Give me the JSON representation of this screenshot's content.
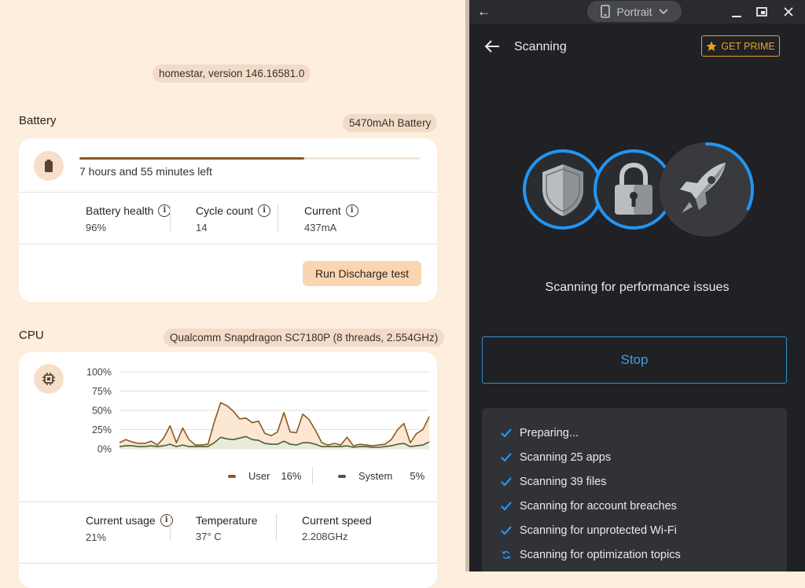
{
  "left": {
    "version_chip": "homestar, version 146.16581.0",
    "battery": {
      "title": "Battery",
      "chip": "5470mAh Battery",
      "time_left": "7 hours and 55 minutes left",
      "charge_fraction": 0.66,
      "stats": [
        {
          "label": "Battery health",
          "value": "96%"
        },
        {
          "label": "Cycle count",
          "value": "14"
        },
        {
          "label": "Current",
          "value": "437mA"
        }
      ],
      "discharge_button": "Run Discharge test"
    },
    "cpu": {
      "title": "CPU",
      "chip": "Qualcomm Snapdragon SC7180P (8 threads, 2.554GHz)",
      "legend": [
        {
          "label": "User",
          "value": "16%",
          "color": "#8a5a1e"
        },
        {
          "label": "System",
          "value": "5%",
          "color": "#4b5e3c"
        }
      ],
      "stats": [
        {
          "label": "Current usage",
          "value": "21%"
        },
        {
          "label": "Temperature",
          "value": "37° C"
        },
        {
          "label": "Current speed",
          "value": "2.208GHz"
        }
      ]
    }
  },
  "chart_data": {
    "type": "area",
    "y_ticks": [
      "100%",
      "75%",
      "50%",
      "25%",
      "0%"
    ],
    "ylim": [
      0,
      100
    ],
    "grid": true,
    "x": [
      0,
      1,
      2,
      3,
      4,
      5,
      6,
      7,
      8,
      9,
      10,
      11,
      12,
      13,
      14,
      15,
      16,
      17,
      18,
      19,
      20,
      21,
      22,
      23,
      24,
      25,
      26,
      27,
      28,
      29,
      30,
      31,
      32,
      33,
      34,
      35,
      36,
      37,
      38,
      39,
      40,
      41,
      42,
      43,
      44,
      45,
      46,
      47,
      48,
      49
    ],
    "series": [
      {
        "name": "User",
        "color": "#8a5a1e",
        "fill": "#fbe2cd",
        "values": [
          8,
          12,
          9,
          7,
          7,
          10,
          5,
          14,
          30,
          8,
          27,
          12,
          5,
          5,
          6,
          35,
          60,
          56,
          49,
          39,
          40,
          34,
          36,
          20,
          17,
          22,
          47,
          22,
          21,
          45,
          38,
          24,
          8,
          5,
          7,
          5,
          15,
          4,
          6,
          5,
          4,
          5,
          6,
          12,
          25,
          33,
          8,
          20,
          25,
          42
        ]
      },
      {
        "name": "System",
        "color": "#4b5e3c",
        "fill": "#e3ecd8",
        "values": [
          3,
          4,
          4,
          3,
          3,
          4,
          3,
          4,
          6,
          3,
          5,
          3,
          3,
          3,
          3,
          8,
          15,
          13,
          12,
          14,
          16,
          12,
          11,
          7,
          6,
          6,
          10,
          6,
          5,
          8,
          8,
          6,
          3,
          3,
          3,
          3,
          4,
          2,
          3,
          3,
          2,
          2,
          3,
          4,
          6,
          7,
          3,
          4,
          5,
          9
        ]
      }
    ]
  },
  "right": {
    "portrait_label": "Portrait",
    "app_title": "Scanning",
    "prime_label": "GET PRIME",
    "scan_status": "Scanning for performance issues",
    "stop_label": "Stop",
    "rocket_progress": 0.32,
    "accent_color": "#2196f3",
    "steps": [
      {
        "label": "Preparing...",
        "state": "done"
      },
      {
        "label": "Scanning 25 apps",
        "state": "done"
      },
      {
        "label": "Scanning 39 files",
        "state": "done"
      },
      {
        "label": "Scanning for account breaches",
        "state": "done"
      },
      {
        "label": "Scanning for unprotected Wi-Fi",
        "state": "done"
      },
      {
        "label": "Scanning for optimization topics",
        "state": "running"
      }
    ]
  }
}
